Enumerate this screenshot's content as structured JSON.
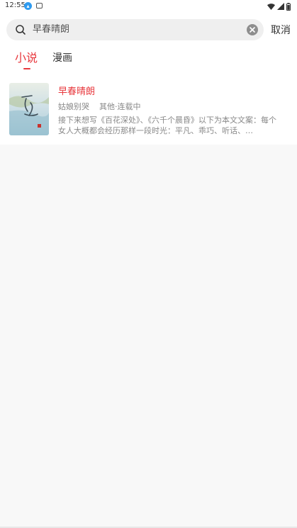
{
  "status_bar": {
    "time": "12:55",
    "icons": [
      "notification-app-icon",
      "screenshot-icon",
      "wifi-icon",
      "signal-icon",
      "battery-icon"
    ]
  },
  "search": {
    "value": "早春晴朗",
    "icon": "search-icon",
    "clear_icon": "close-circle-icon",
    "cancel_label": "取消"
  },
  "tabs": [
    {
      "label": "小说",
      "active": true
    },
    {
      "label": "漫画",
      "active": false
    }
  ],
  "results": [
    {
      "title": "早春晴朗",
      "author": "姑娘别哭",
      "category": "其他",
      "status": "连载中",
      "separator": "·",
      "description": "接下来想写《百花深处》、《六千个晨昏》以下为本文文案：每个女人大概都会经历那样一段时光：平凡、乖巧、听话、…",
      "cover_text": "早春晴朗"
    }
  ],
  "colors": {
    "accent": "#e8383d",
    "background": "#f8f8f8",
    "surface": "#ffffff",
    "search_bg": "#efefef",
    "muted_text": "#888888"
  }
}
